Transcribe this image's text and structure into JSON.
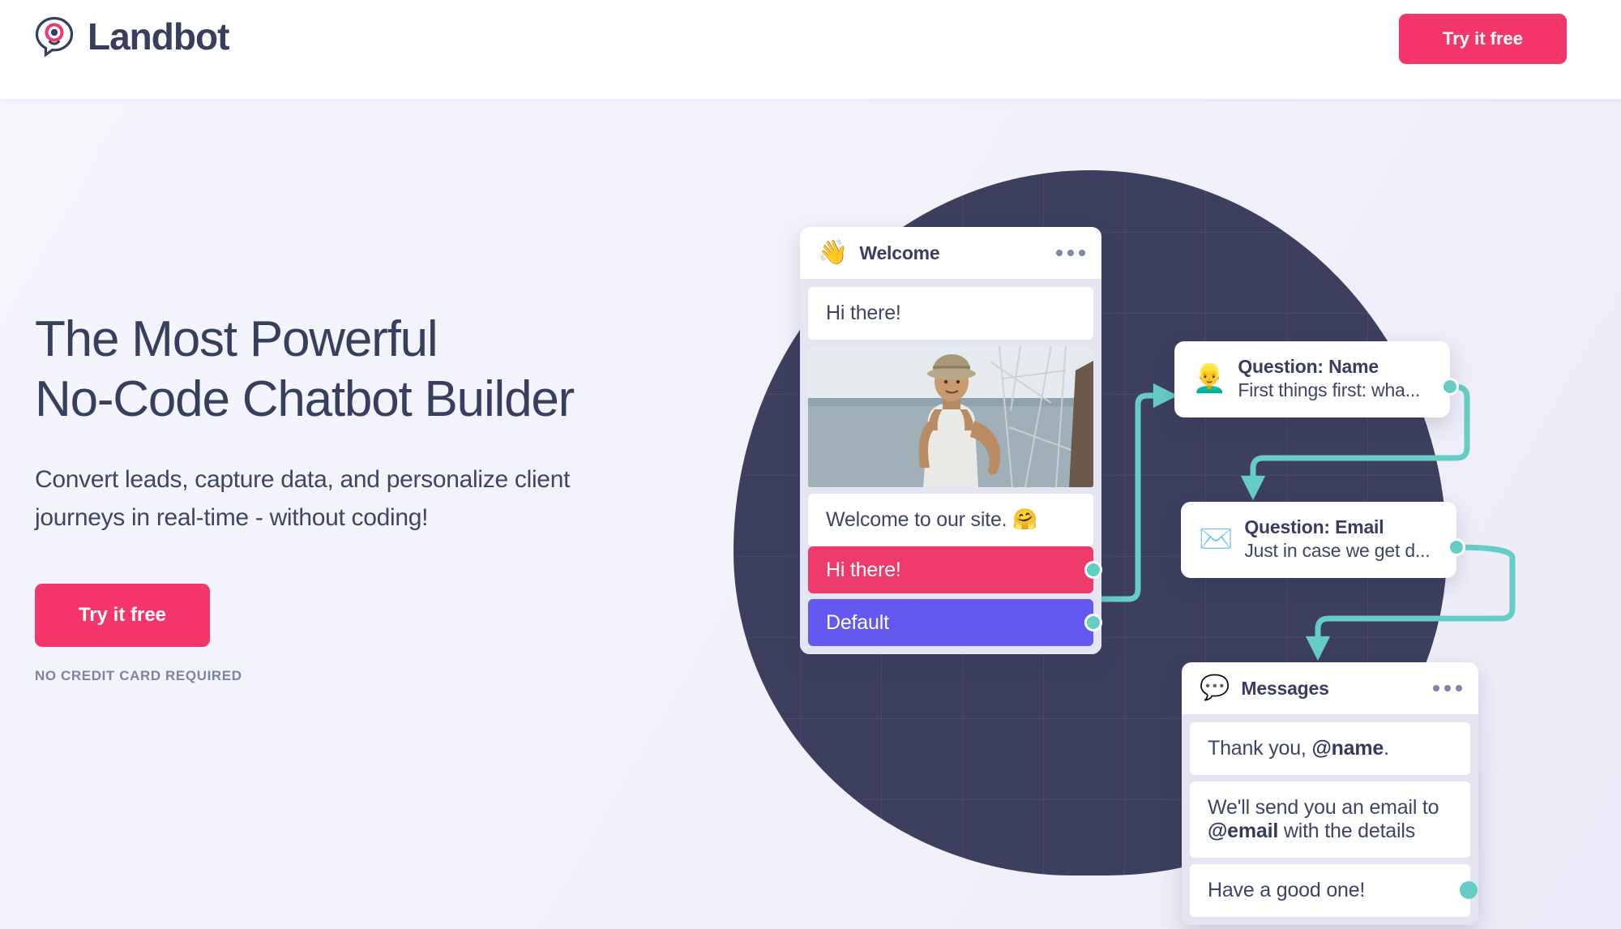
{
  "header": {
    "logo_text": "Landbot",
    "logo_icon": "landbot-speech-bubble-logo",
    "cta_label": "Try it free"
  },
  "hero": {
    "headline_line1": "The Most Powerful",
    "headline_line2": "No-Code Chatbot Builder",
    "subheadline": "Convert leads, capture data, and personalize client journeys in real-time - without coding!",
    "cta_label": "Try it free",
    "cta_note": "NO CREDIT CARD REQUIRED"
  },
  "colors": {
    "brand_pink": "#f4366b",
    "choice_pink": "#ef3b6c",
    "choice_purple": "#6358f0",
    "connector_teal": "#66cdc6",
    "navy": "#3d3f5f",
    "text_navy": "#36405e",
    "muted": "#7b84a8"
  },
  "flow": {
    "welcome_card": {
      "emoji": "👋",
      "emoji_name": "waving-hand-emoji",
      "title": "Welcome",
      "menu_icon": "more-options-icon",
      "bubble_1": "Hi there!",
      "image_alt": "man-in-hat-by-the-sea-photo",
      "bubble_2": "Welcome to our site. 🤗",
      "choice_1": "Hi there!",
      "choice_2": "Default"
    },
    "question_name_card": {
      "emoji": "👱‍♂️",
      "emoji_name": "blond-man-emoji",
      "title": "Question: Name",
      "subtitle": "First things first: wha..."
    },
    "question_email_card": {
      "emoji": "✉️",
      "emoji_name": "envelope-emoji",
      "title": "Question: Email",
      "subtitle": "Just in case we get d..."
    },
    "messages_card": {
      "emoji": "💬",
      "emoji_name": "speech-balloon-emoji",
      "title": "Messages",
      "menu_icon": "more-options-icon",
      "message_1_prefix": "Thank you, ",
      "message_1_var": "@name",
      "message_1_suffix": ".",
      "message_2_prefix": "We'll send you an email to ",
      "message_2_var": "@email",
      "message_2_suffix": " with the details",
      "message_3": "Have a good one!"
    }
  }
}
